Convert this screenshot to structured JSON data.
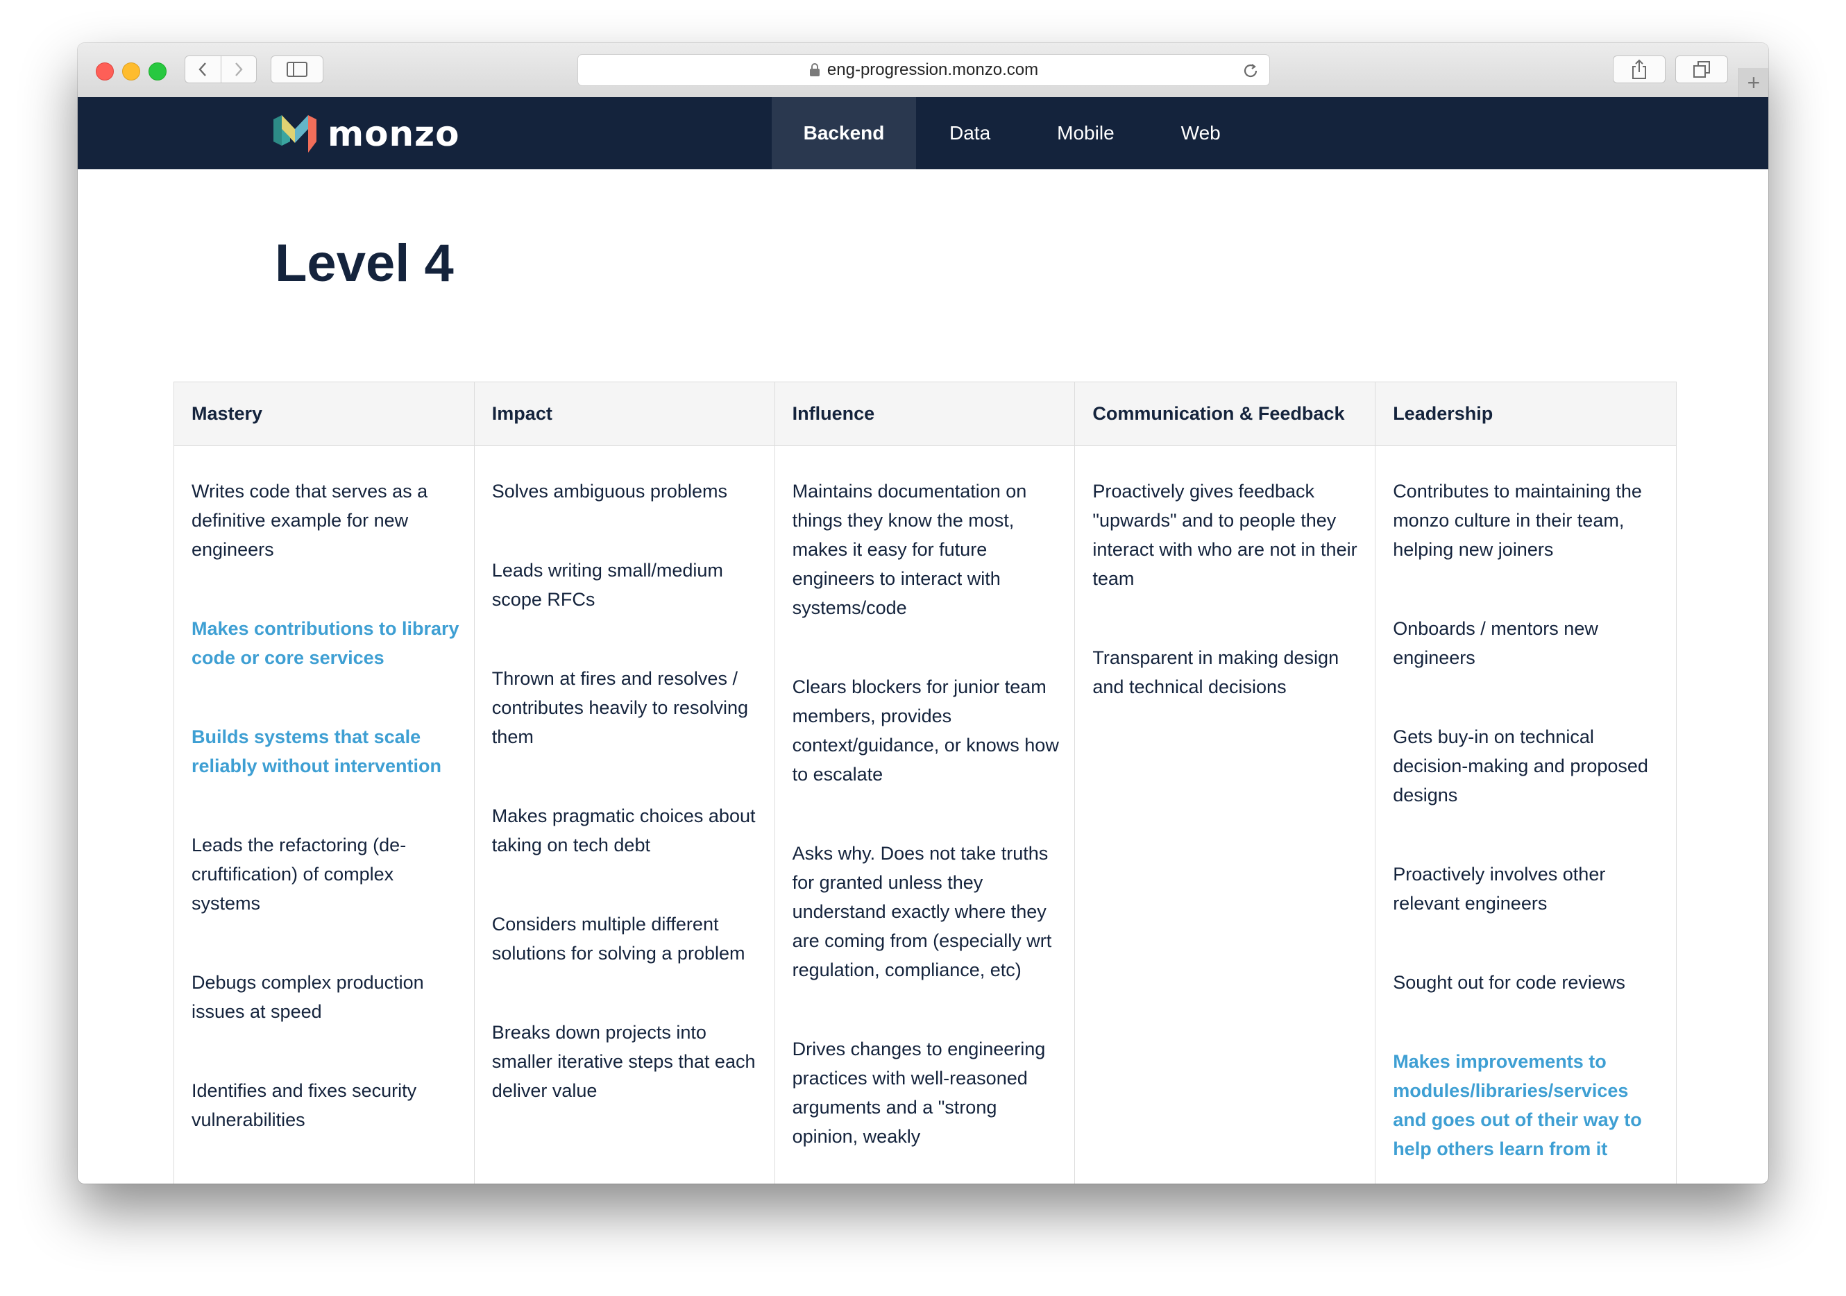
{
  "browser": {
    "url": "eng-progression.monzo.com",
    "new_tab_label": "+"
  },
  "header": {
    "logo_text": "monzo",
    "nav": [
      {
        "label": "Backend",
        "active": true
      },
      {
        "label": "Data",
        "active": false
      },
      {
        "label": "Mobile",
        "active": false
      },
      {
        "label": "Web",
        "active": false
      }
    ]
  },
  "page": {
    "title": "Level 4"
  },
  "columns": [
    {
      "header": "Mastery",
      "items": [
        {
          "text": "Writes code that serves as a definitive example for new engineers",
          "highlight": false
        },
        {
          "text": "Makes contributions to library code or core services",
          "highlight": true
        },
        {
          "text": "Builds systems that scale reliably without intervention",
          "highlight": true
        },
        {
          "text": "Leads the refactoring (de-cruftification) of complex systems",
          "highlight": false
        },
        {
          "text": "Debugs complex production issues at speed",
          "highlight": false
        },
        {
          "text": "Identifies and fixes security vulnerabilities",
          "highlight": false
        }
      ]
    },
    {
      "header": "Impact",
      "items": [
        {
          "text": "Solves ambiguous problems",
          "highlight": false
        },
        {
          "text": "Leads writing small/medium scope RFCs",
          "highlight": false
        },
        {
          "text": "Thrown at fires and resolves / contributes heavily to resolving them",
          "highlight": false
        },
        {
          "text": "Makes pragmatic choices about taking on tech debt",
          "highlight": false
        },
        {
          "text": "Considers multiple different solutions for solving a problem",
          "highlight": false
        },
        {
          "text": "Breaks down projects into smaller iterative steps that each deliver value",
          "highlight": false
        }
      ]
    },
    {
      "header": "Influence",
      "items": [
        {
          "text": "Maintains documentation on things they know the most, makes it easy for future engineers to interact with systems/code",
          "highlight": false
        },
        {
          "text": "Clears blockers for junior team members, provides context/guidance, or knows how to escalate",
          "highlight": false
        },
        {
          "text": "Asks why. Does not take truths for granted unless they understand exactly where they are coming from (especially wrt regulation, compliance, etc)",
          "highlight": false
        },
        {
          "text": "Drives changes to engineering practices with well-reasoned arguments and a \"strong opinion, weakly",
          "highlight": false
        }
      ]
    },
    {
      "header": "Communication & Feedback",
      "items": [
        {
          "text": "Proactively gives feedback \"upwards\" and to people they interact with who are not in their team",
          "highlight": false
        },
        {
          "text": "Transparent in making design and technical decisions",
          "highlight": false
        }
      ]
    },
    {
      "header": "Leadership",
      "items": [
        {
          "text": "Contributes to maintaining the monzo culture in their team, helping new joiners",
          "highlight": false
        },
        {
          "text": "Onboards / mentors new engineers",
          "highlight": false
        },
        {
          "text": "Gets buy-in on technical decision-making and proposed designs",
          "highlight": false
        },
        {
          "text": "Proactively involves other relevant engineers",
          "highlight": false
        },
        {
          "text": "Sought out for code reviews",
          "highlight": false
        },
        {
          "text": "Makes improvements to modules/libraries/services and goes out of their way to help others learn from it",
          "highlight": true
        }
      ]
    }
  ]
}
